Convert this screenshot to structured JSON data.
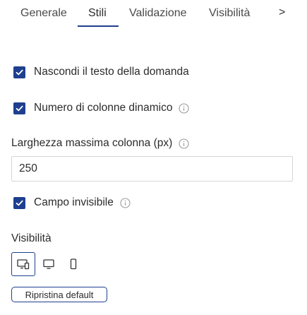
{
  "tabs": [
    {
      "label": "Generale"
    },
    {
      "label": "Stili"
    },
    {
      "label": "Validazione"
    },
    {
      "label": "Visibilità"
    }
  ],
  "tab_more_label": ">",
  "options": {
    "hide_title": {
      "label": "Nascondi il testo della domanda",
      "checked": true
    },
    "dynamic_columns": {
      "label": "Numero di colonne dinamico",
      "checked": true
    },
    "invisible": {
      "label": "Campo invisibile",
      "checked": true
    }
  },
  "max_column_width": {
    "label": "Larghezza massima colonna (px)",
    "value": "250"
  },
  "visibility": {
    "label": "Visibilità",
    "devices": [
      "all-devices-icon",
      "desktop-icon",
      "mobile-icon"
    ],
    "selected": "all-devices-icon"
  },
  "reset_button": {
    "label": "Ripristina default"
  },
  "colors": {
    "accent": "#1f3f8f",
    "border": "#d6d6d6",
    "text": "#2b2b2b"
  }
}
